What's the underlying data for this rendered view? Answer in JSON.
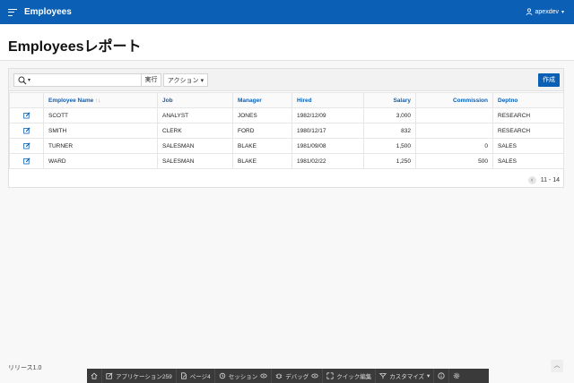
{
  "header": {
    "app_title": "Employees",
    "user_name": "apexdev"
  },
  "page": {
    "title": "Employeesレポート"
  },
  "toolbar": {
    "go_label": "実行",
    "actions_label": "アクション",
    "create_label": "作成"
  },
  "table": {
    "columns": [
      "Employee Name",
      "Job",
      "Manager",
      "Hired",
      "Salary",
      "Commission",
      "Deptno"
    ],
    "rows": [
      [
        "SCOTT",
        "ANALYST",
        "JONES",
        "1982/12/09",
        "3,000",
        "",
        "RESEARCH"
      ],
      [
        "SMITH",
        "CLERK",
        "FORD",
        "1980/12/17",
        "832",
        "",
        "RESEARCH"
      ],
      [
        "TURNER",
        "SALESMAN",
        "BLAKE",
        "1981/09/08",
        "1,500",
        "0",
        "SALES"
      ],
      [
        "WARD",
        "SALESMAN",
        "BLAKE",
        "1981/02/22",
        "1,250",
        "500",
        "SALES"
      ]
    ]
  },
  "pagination": {
    "range": "11 - 14"
  },
  "footer": {
    "release": "リリース1.0"
  },
  "devbar": {
    "items": [
      {
        "label": "",
        "icon": "home-icon"
      },
      {
        "label": "アプリケーション259",
        "icon": "edit-app-icon"
      },
      {
        "label": "ページ4",
        "icon": "page-icon"
      },
      {
        "label": "セッション",
        "icon": "session-icon"
      },
      {
        "label": "デバッグ",
        "icon": "debug-icon"
      },
      {
        "label": "クイック編集",
        "icon": "quick-edit-icon"
      },
      {
        "label": "カスタマイズ",
        "icon": "customize-icon"
      },
      {
        "label": "",
        "icon": "info-icon"
      },
      {
        "label": "",
        "icon": "settings-icon"
      }
    ]
  },
  "colors": {
    "accent": "#0b5fb4",
    "devbar": "#3a3a3a"
  }
}
